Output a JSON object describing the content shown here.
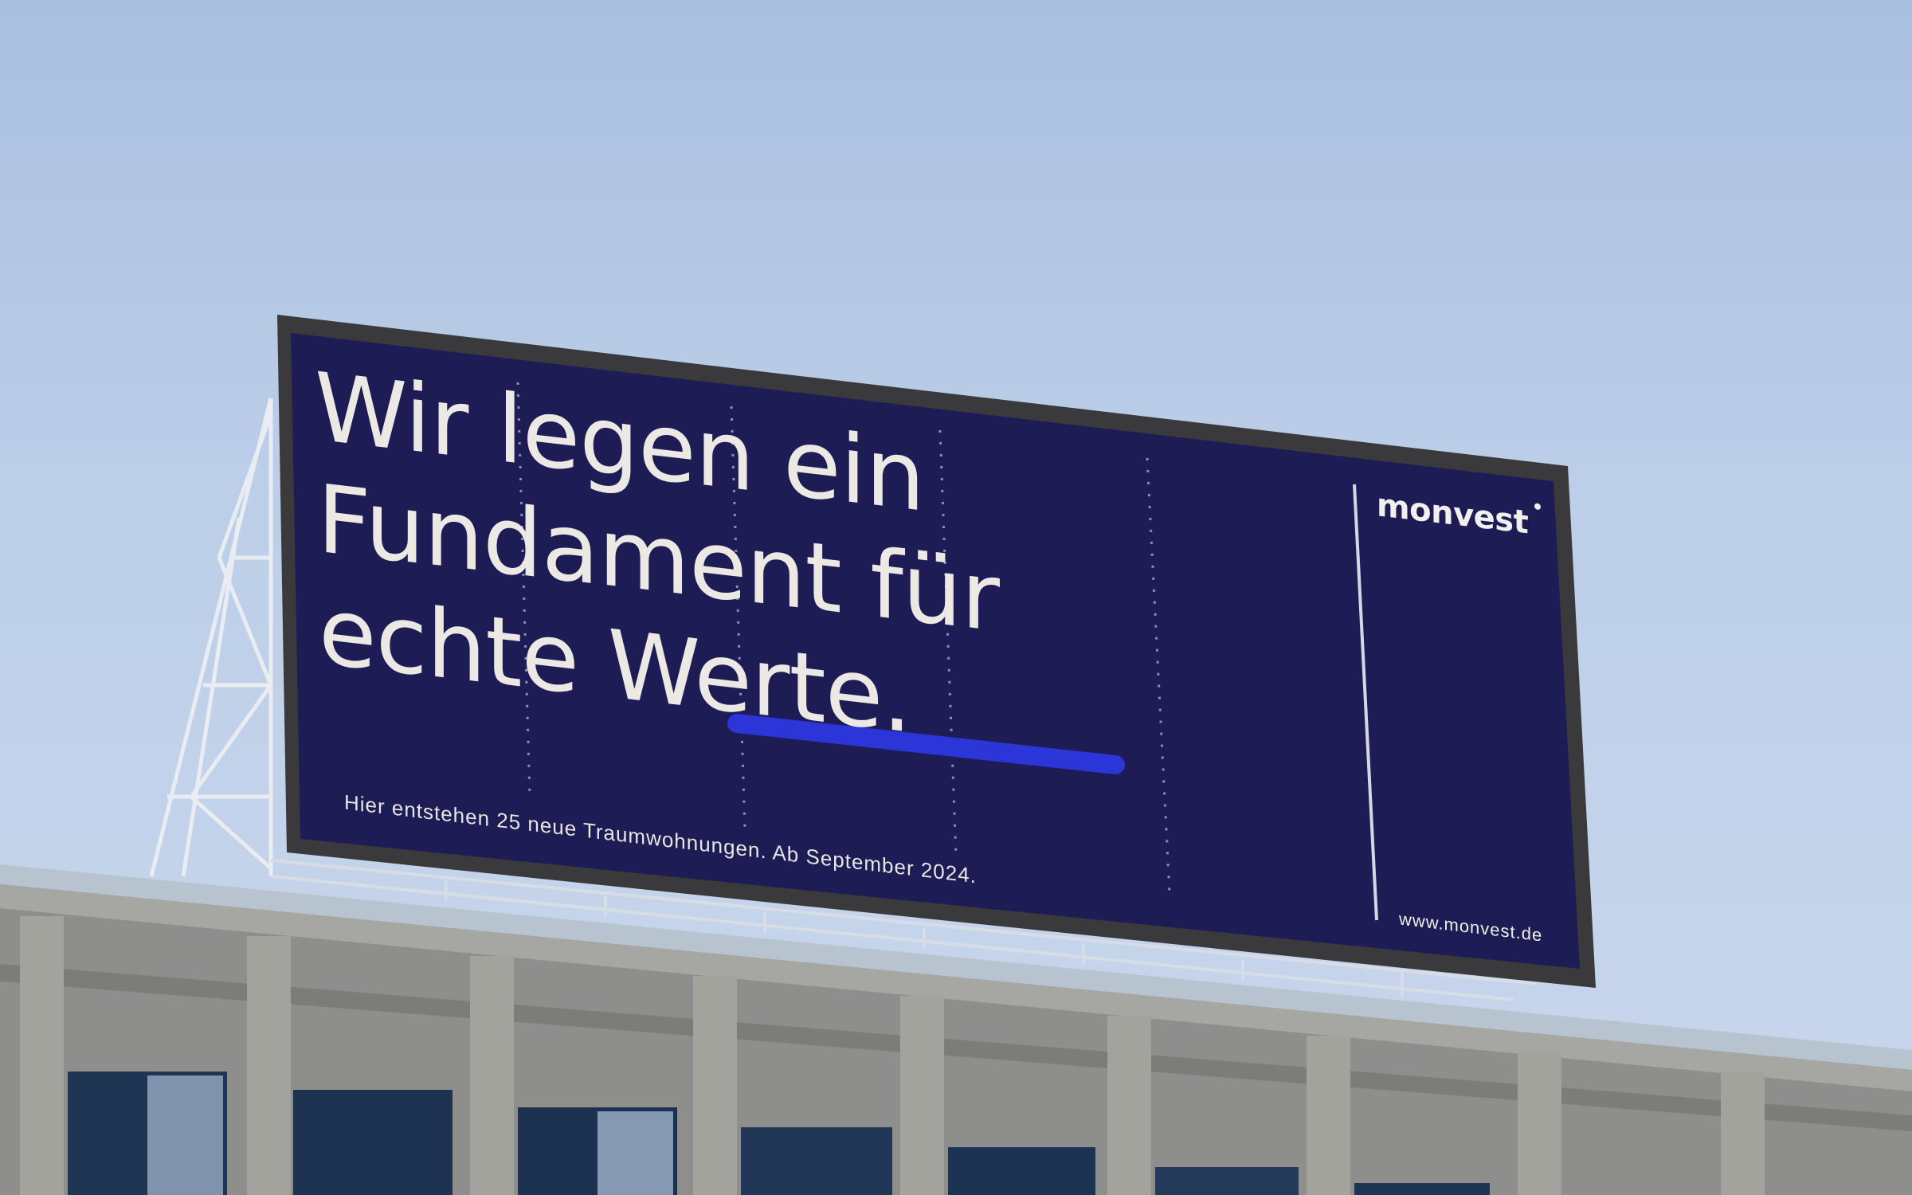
{
  "billboard": {
    "headline_line1": "Wir legen ein",
    "headline_line2": "Fundament für",
    "headline_line3_a": "echte ",
    "headline_line3_b": "Werte",
    "headline_period": ".",
    "subline": "Hier entstehen 25 neue Traumwohnungen. Ab September 2024.",
    "logo": "monvest",
    "url": "www.monvest.de"
  },
  "colors": {
    "billboard_bg": "#1e1c55",
    "accent_underline": "#2b35d8",
    "text": "#ece9e4"
  }
}
